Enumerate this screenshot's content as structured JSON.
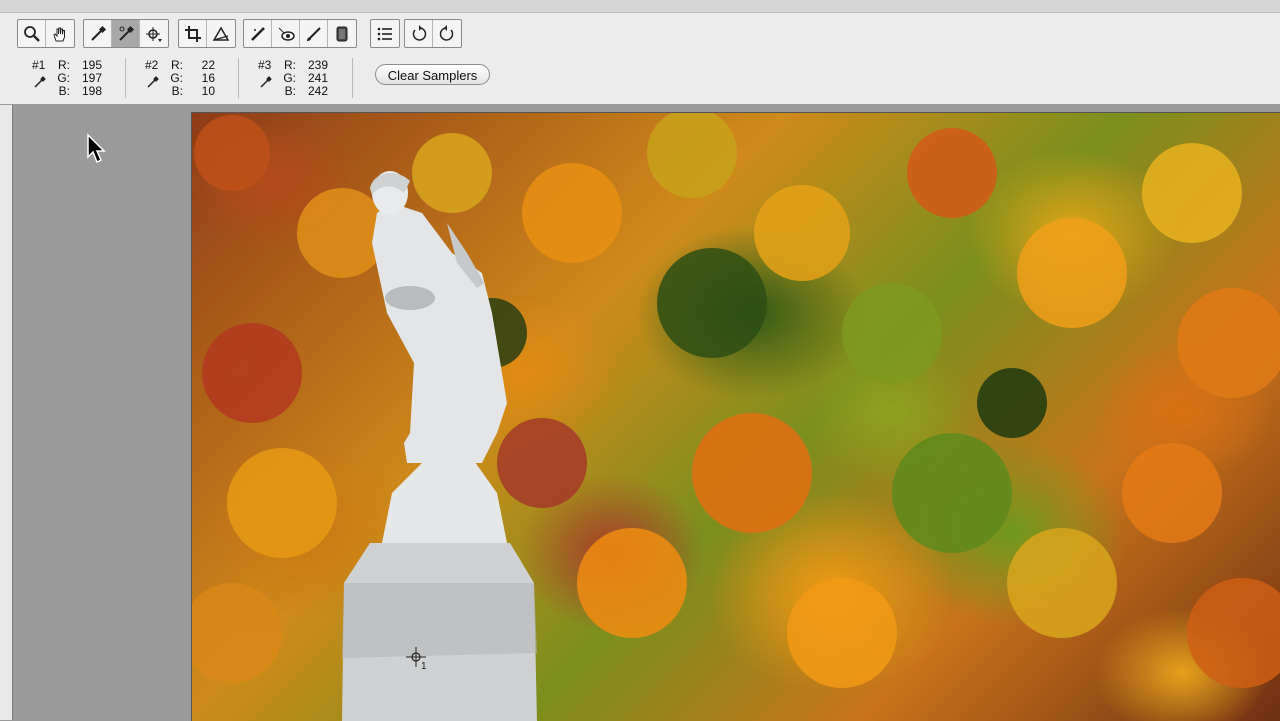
{
  "toolbar": {
    "tools": [
      {
        "icon": "zoom-icon"
      },
      {
        "icon": "hand-icon"
      },
      {
        "icon": "white-balance-icon"
      },
      {
        "icon": "color-sampler-icon",
        "active": true
      },
      {
        "icon": "targeted-adjustment-icon"
      },
      {
        "icon": "crop-icon"
      },
      {
        "icon": "straighten-icon"
      },
      {
        "icon": "spot-removal-icon"
      },
      {
        "icon": "red-eye-icon"
      },
      {
        "icon": "adjustment-brush-icon"
      },
      {
        "icon": "graduated-filter-icon"
      },
      {
        "icon": "preferences-list-icon"
      },
      {
        "icon": "rotate-left-icon"
      },
      {
        "icon": "rotate-right-icon"
      }
    ]
  },
  "samplers": [
    {
      "num": "#1",
      "r_label": "R:",
      "g_label": "G:",
      "b_label": "B:",
      "r": "195",
      "g": "197",
      "b": "198"
    },
    {
      "num": "#2",
      "r_label": "R:",
      "g_label": "G:",
      "b_label": "B:",
      "r": "22",
      "g": "16",
      "b": "10"
    },
    {
      "num": "#3",
      "r_label": "R:",
      "g_label": "G:",
      "b_label": "B:",
      "r": "239",
      "g": "241",
      "b": "242"
    }
  ],
  "clear_samplers_label": "Clear Samplers",
  "image": {
    "sampler_marker_label": "1"
  }
}
